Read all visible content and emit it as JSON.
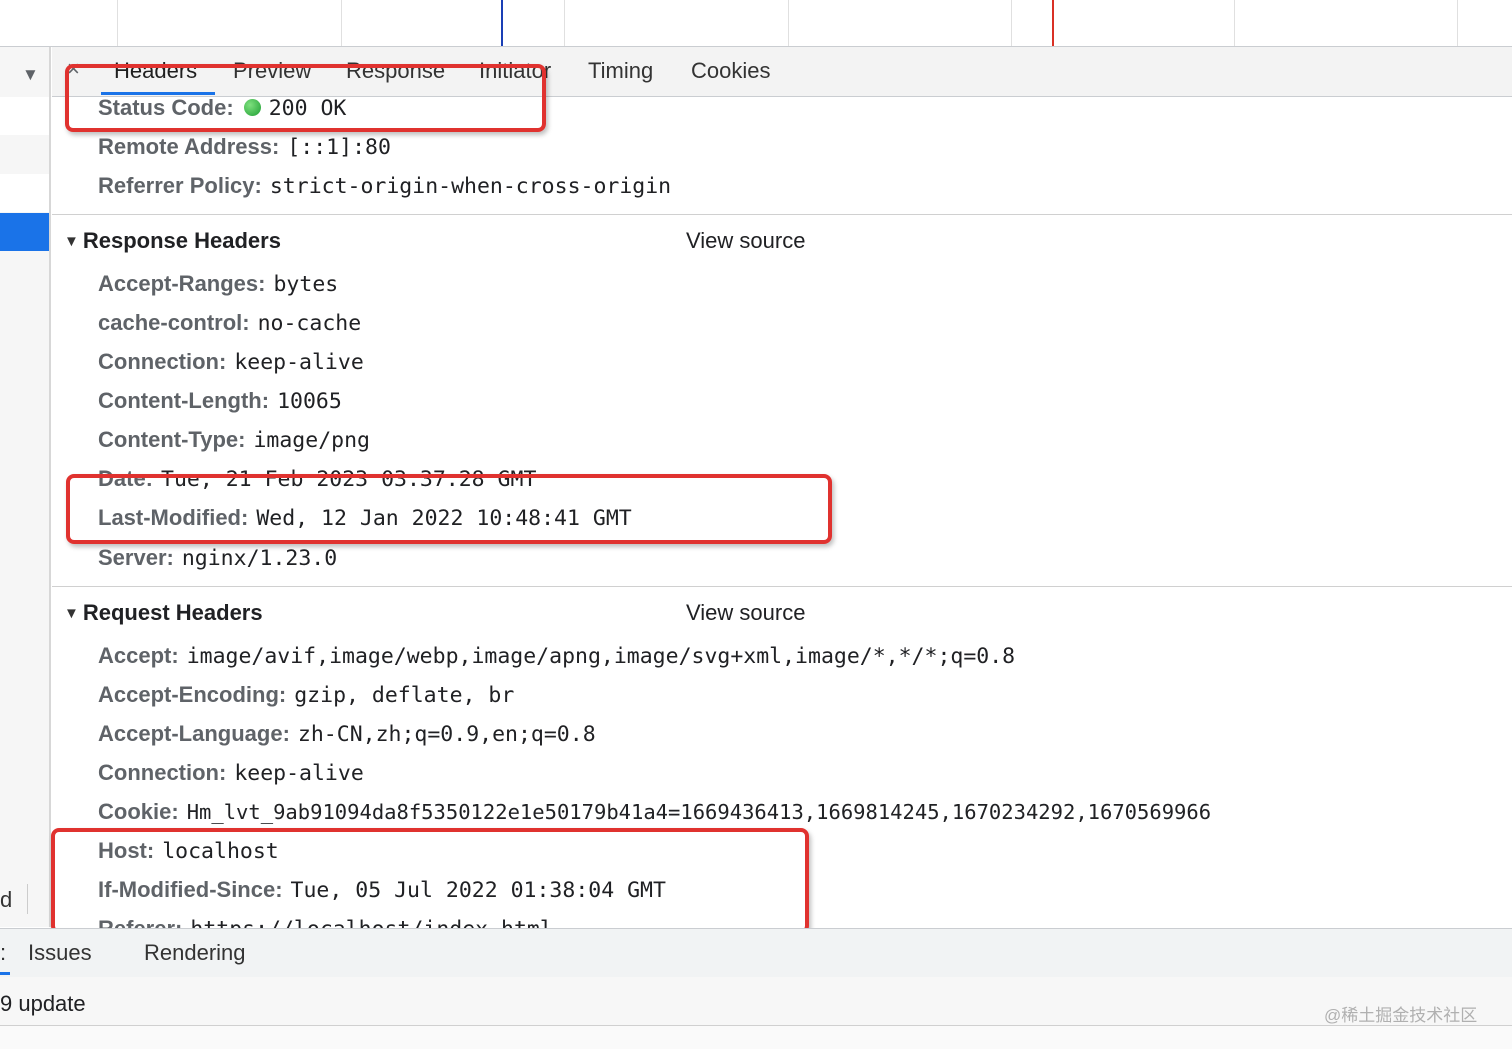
{
  "tabs": {
    "close": "×",
    "items": [
      "Headers",
      "Preview",
      "Response",
      "Initiator",
      "Timing",
      "Cookies"
    ]
  },
  "general": {
    "status_code_key": "Status Code:",
    "status_code_val": "200 OK",
    "remote_address_key": "Remote Address:",
    "remote_address_val": "[::1]:80",
    "referrer_policy_key": "Referrer Policy:",
    "referrer_policy_val": "strict-origin-when-cross-origin"
  },
  "response_headers": {
    "title": "Response Headers",
    "view_source": "View source",
    "items": [
      {
        "key": "Accept-Ranges:",
        "val": "bytes"
      },
      {
        "key": "cache-control:",
        "val": "no-cache"
      },
      {
        "key": "Connection:",
        "val": "keep-alive"
      },
      {
        "key": "Content-Length:",
        "val": "10065"
      },
      {
        "key": "Content-Type:",
        "val": "image/png"
      },
      {
        "key": "Date:",
        "val": "Tue, 21 Feb 2023 03:37:28 GMT"
      },
      {
        "key": "Last-Modified:",
        "val": "Wed, 12 Jan 2022 10:48:41 GMT"
      },
      {
        "key": "Server:",
        "val": "nginx/1.23.0"
      }
    ]
  },
  "request_headers": {
    "title": "Request Headers",
    "view_source": "View source",
    "items": [
      {
        "key": "Accept:",
        "val": "image/avif,image/webp,image/apng,image/svg+xml,image/*,*/*;q=0.8"
      },
      {
        "key": "Accept-Encoding:",
        "val": "gzip, deflate, br"
      },
      {
        "key": "Accept-Language:",
        "val": "zh-CN,zh;q=0.9,en;q=0.8"
      },
      {
        "key": "Connection:",
        "val": "keep-alive"
      },
      {
        "key": "Cookie:",
        "val": "Hm_lvt_9ab91094da8f5350122e1e50179b41a4=1669436413,1669814245,1670234292,1670569966"
      },
      {
        "key": "Host:",
        "val": "localhost"
      },
      {
        "key": "If-Modified-Since:",
        "val": "Tue, 05 Jul 2022 01:38:04 GMT"
      },
      {
        "key": "Referer:",
        "val": "https://localhost/index.html"
      }
    ]
  },
  "left": {
    "footer_text": "d"
  },
  "drawer": {
    "left_mark": ":",
    "tabs": [
      "Issues",
      "Rendering"
    ],
    "body_text": "9 update"
  },
  "watermark": "@稀土掘金技术社区"
}
